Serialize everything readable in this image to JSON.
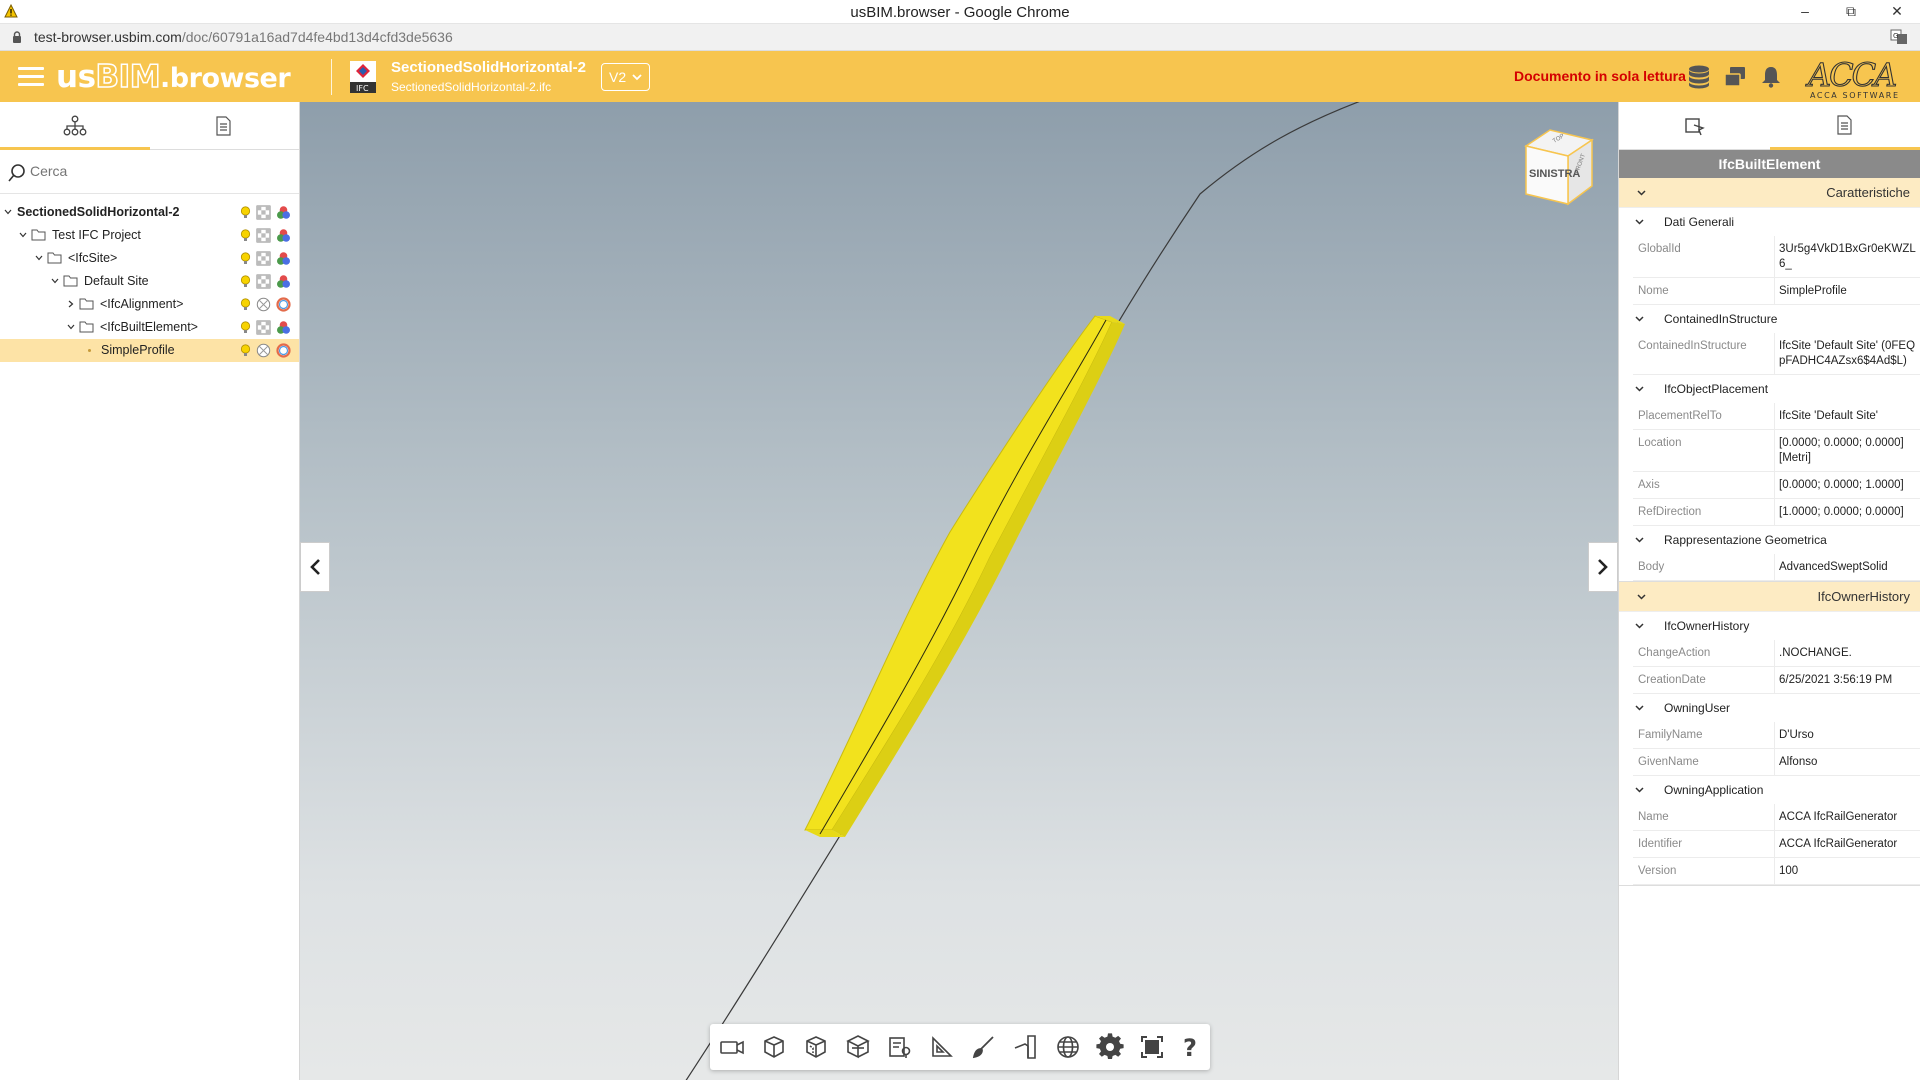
{
  "window": {
    "title": "usBIM.browser - Google Chrome",
    "minimize": "–",
    "restore": "⧉",
    "close": "✕"
  },
  "address": {
    "host": "test-browser.usbim.com",
    "path": "/doc/60791a16ad7d4fe4bd13d4cfd3de5636"
  },
  "header": {
    "logo_us": "us",
    "logo_bim": "BIM",
    "logo_browser": ".browser",
    "doc_title": "SectionedSolidHorizontal-2",
    "doc_file": "SectionedSolidHorizontal-2.ifc",
    "ifc_badge": "IFC",
    "version": "V2",
    "readonly_label": "Documento in sola lettura",
    "brand": "ACCA",
    "brand_sub": "ACCA SOFTWARE"
  },
  "left_panel": {
    "search_placeholder": "Cerca",
    "tree": [
      {
        "label": "SectionedSolidHorizontal-2",
        "bold": true
      },
      {
        "label": "Test IFC Project"
      },
      {
        "label": "<IfcSite>"
      },
      {
        "label": "Default Site"
      },
      {
        "label": "<IfcAlignment>"
      },
      {
        "label": "<IfcBuiltElement>"
      },
      {
        "label": "SimpleProfile",
        "selected": true
      }
    ]
  },
  "viewer": {
    "viewcube_face": "SINISTRA",
    "viewcube_top": "TOP",
    "viewcube_side": "FRONT"
  },
  "right_panel": {
    "title": "IfcBuiltElement",
    "sections": {
      "caratteristiche": "Caratteristiche",
      "owner_history": "IfcOwnerHistory"
    },
    "groups": {
      "dati_generali": "Dati Generali",
      "contained": "ContainedInStructure",
      "placement": "IfcObjectPlacement",
      "rappresentazione": "Rappresentazione Geometrica",
      "owner_history": "IfcOwnerHistory",
      "owning_user": "OwningUser",
      "owning_app": "OwningApplication"
    },
    "props": {
      "globalid_k": "GlobalId",
      "globalid_v": "3Ur5g4VkD1BxGr0eKWZL6_",
      "nome_k": "Nome",
      "nome_v": "SimpleProfile",
      "contained_k": "ContainedInStructure",
      "contained_v": "IfcSite 'Default Site' (0FEQpFADHC4AZsx6$4Ad$L)",
      "placementrel_k": "PlacementRelTo",
      "placementrel_v": "IfcSite 'Default Site'",
      "location_k": "Location",
      "location_v": "[0.0000; 0.0000; 0.0000] [Metri]",
      "axis_k": "Axis",
      "axis_v": "[0.0000; 0.0000; 1.0000]",
      "refdir_k": "RefDirection",
      "refdir_v": "[1.0000; 0.0000; 0.0000]",
      "body_k": "Body",
      "body_v": "AdvancedSweptSolid",
      "change_k": "ChangeAction",
      "change_v": ".NOCHANGE.",
      "creation_k": "CreationDate",
      "creation_v": "6/25/2021 3:56:19 PM",
      "family_k": "FamilyName",
      "family_v": "D'Urso",
      "given_k": "GivenName",
      "given_v": "Alfonso",
      "appname_k": "Name",
      "appname_v": "ACCA IfcRailGenerator",
      "ident_k": "Identifier",
      "ident_v": "ACCA IfcRailGenerator",
      "version_k": "Version",
      "version_v": "100"
    }
  },
  "colors": {
    "accent": "#f7c54f",
    "selection": "#fde3a6",
    "model": "#f2e21d",
    "readonly": "#d40000"
  }
}
